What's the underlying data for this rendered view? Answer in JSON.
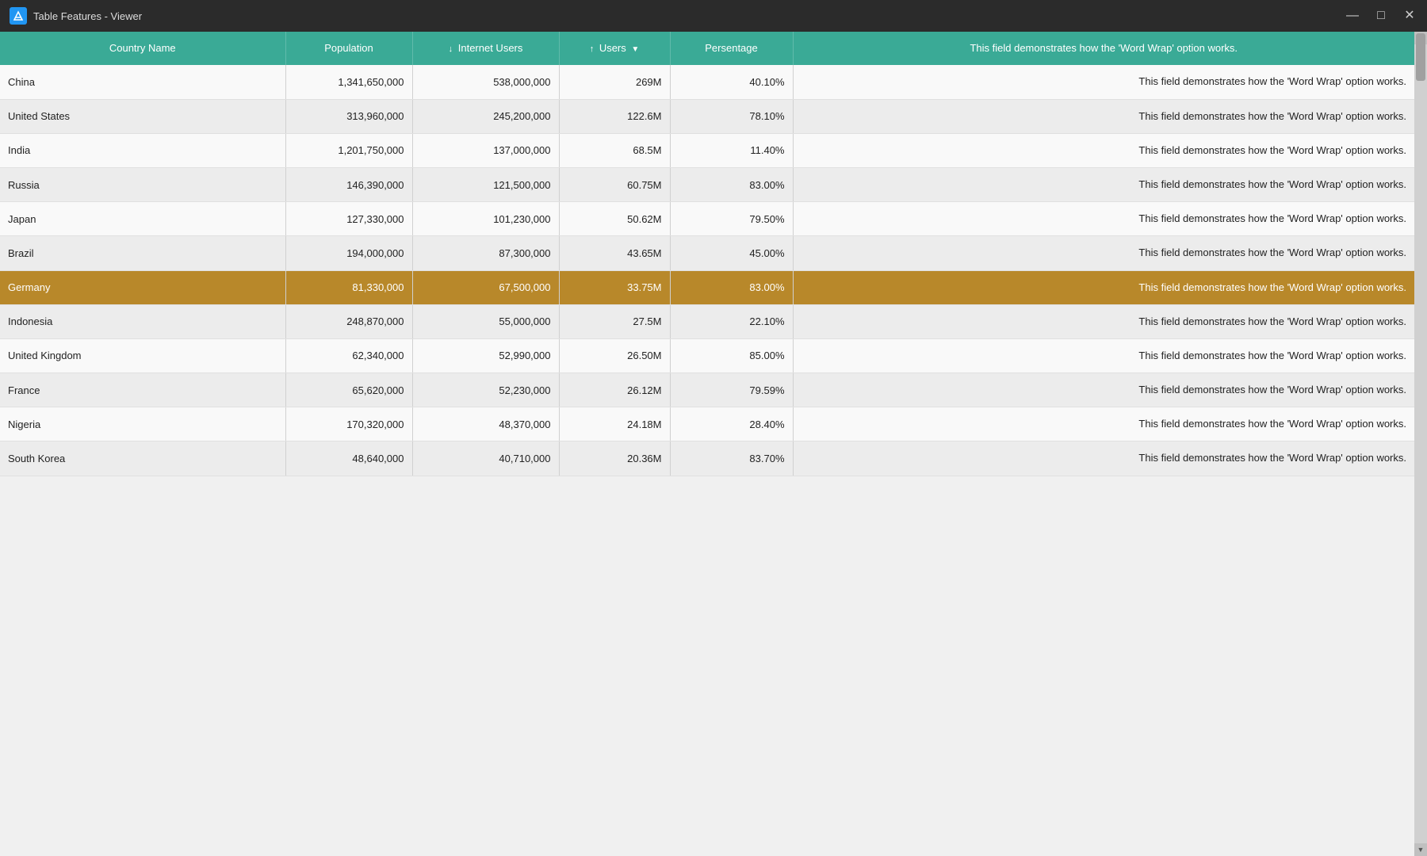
{
  "window": {
    "title": "Table Features - Viewer",
    "logo": "LS",
    "controls": {
      "minimize": "—",
      "maximize": "□",
      "close": "✕"
    }
  },
  "table": {
    "columns": [
      {
        "id": "country",
        "label": "Country Name",
        "sort": null
      },
      {
        "id": "population",
        "label": "Population",
        "sort": null
      },
      {
        "id": "internet_users",
        "label": "Internet Users",
        "sort": "desc"
      },
      {
        "id": "users",
        "label": "Users",
        "sort": "asc",
        "dropdown": true
      },
      {
        "id": "percentage",
        "label": "Persentage",
        "sort": null
      },
      {
        "id": "word_wrap",
        "label": "This field demonstrates how the 'Word Wrap' option works.",
        "sort": null
      }
    ],
    "rows": [
      {
        "country": "China",
        "population": "1,341,650,000",
        "internet_users": "538,000,000",
        "users": "269M",
        "percentage": "40.10%",
        "word_wrap": "This field demonstrates how the 'Word Wrap' option works.",
        "selected": false
      },
      {
        "country": "United States",
        "population": "313,960,000",
        "internet_users": "245,200,000",
        "users": "122.6M",
        "percentage": "78.10%",
        "word_wrap": "This field demonstrates how the 'Word Wrap' option works.",
        "selected": false
      },
      {
        "country": "India",
        "population": "1,201,750,000",
        "internet_users": "137,000,000",
        "users": "68.5M",
        "percentage": "11.40%",
        "word_wrap": "This field demonstrates how the 'Word Wrap' option works.",
        "selected": false
      },
      {
        "country": "Russia",
        "population": "146,390,000",
        "internet_users": "121,500,000",
        "users": "60.75M",
        "percentage": "83.00%",
        "word_wrap": "This field demonstrates how the 'Word Wrap' option works.",
        "selected": false
      },
      {
        "country": "Japan",
        "population": "127,330,000",
        "internet_users": "101,230,000",
        "users": "50.62M",
        "percentage": "79.50%",
        "word_wrap": "This field demonstrates how the 'Word Wrap' option works.",
        "selected": false
      },
      {
        "country": "Brazil",
        "population": "194,000,000",
        "internet_users": "87,300,000",
        "users": "43.65M",
        "percentage": "45.00%",
        "word_wrap": "This field demonstrates how the 'Word Wrap' option works.",
        "selected": false
      },
      {
        "country": "Germany",
        "population": "81,330,000",
        "internet_users": "67,500,000",
        "users": "33.75M",
        "percentage": "83.00%",
        "word_wrap": "This field demonstrates how the 'Word Wrap' option works.",
        "selected": true
      },
      {
        "country": "Indonesia",
        "population": "248,870,000",
        "internet_users": "55,000,000",
        "users": "27.5M",
        "percentage": "22.10%",
        "word_wrap": "This field demonstrates how the 'Word Wrap' option works.",
        "selected": false
      },
      {
        "country": "United Kingdom",
        "population": "62,340,000",
        "internet_users": "52,990,000",
        "users": "26.50M",
        "percentage": "85.00%",
        "word_wrap": "This field demonstrates how the 'Word Wrap' option works.",
        "selected": false
      },
      {
        "country": "France",
        "population": "65,620,000",
        "internet_users": "52,230,000",
        "users": "26.12M",
        "percentage": "79.59%",
        "word_wrap": "This field demonstrates how the 'Word Wrap' option works.",
        "selected": false
      },
      {
        "country": "Nigeria",
        "population": "170,320,000",
        "internet_users": "48,370,000",
        "users": "24.18M",
        "percentage": "28.40%",
        "word_wrap": "This field demonstrates how the 'Word Wrap' option works.",
        "selected": false
      },
      {
        "country": "South Korea",
        "population": "48,640,000",
        "internet_users": "40,710,000",
        "users": "20.36M",
        "percentage": "83.70%",
        "word_wrap": "This field demonstrates how the 'Word Wrap' option works.",
        "selected": false
      }
    ]
  },
  "colors": {
    "header_bg": "#3aaa96",
    "selected_row": "#b8882a",
    "title_bar": "#2b2b2b"
  }
}
